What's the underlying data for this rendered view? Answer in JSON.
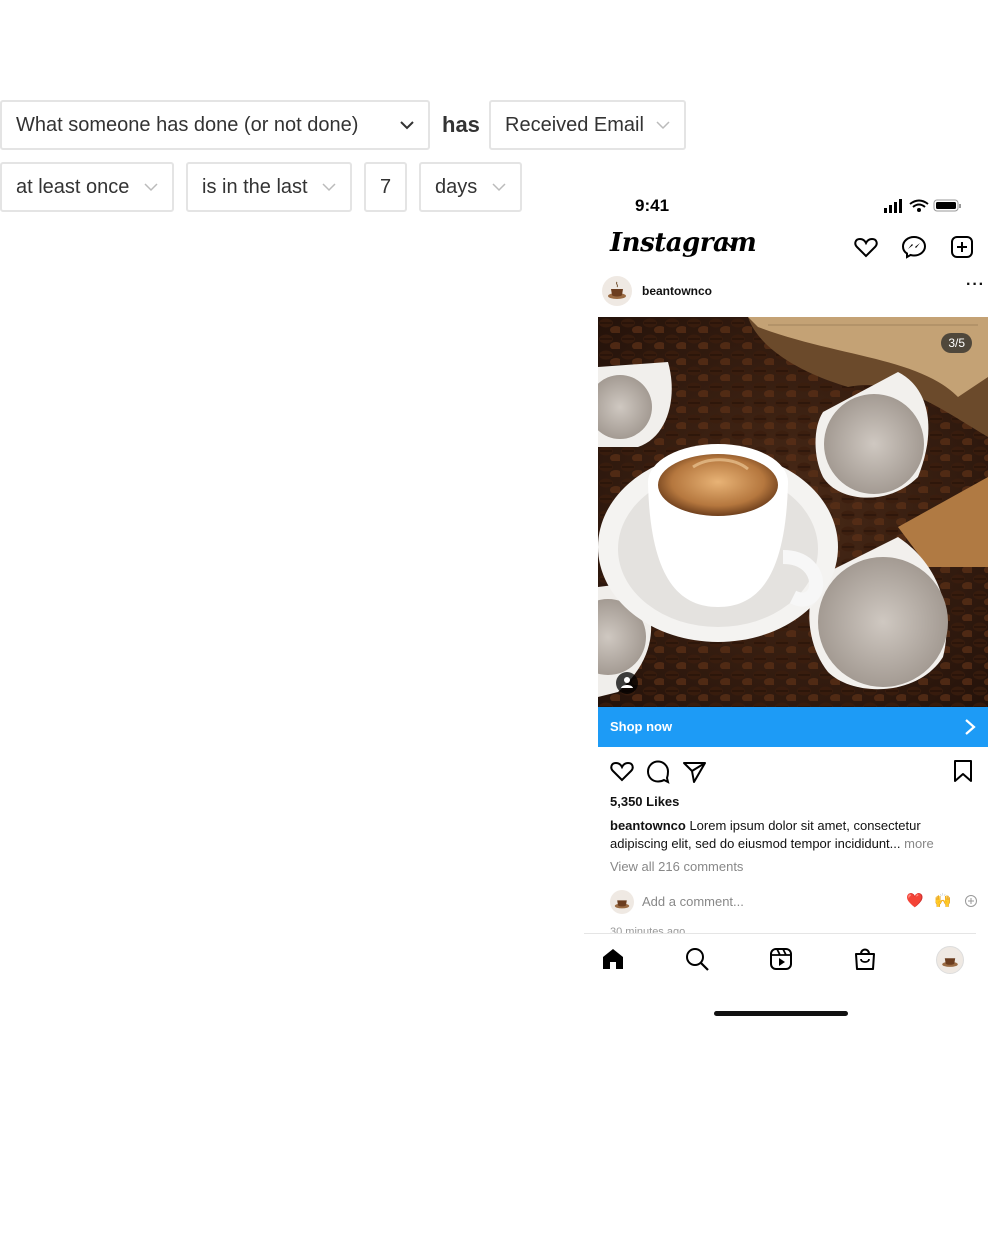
{
  "filter": {
    "condition_select": "What someone has done (or not done)",
    "has_label": "has",
    "event_select": "Received Email",
    "frequency_select": "at least once",
    "time_operator_select": "is in the last",
    "time_value": "7",
    "time_unit_select": "days"
  },
  "phone": {
    "status_time": "9:41",
    "app_logo": "Instagram",
    "post": {
      "username": "beantownco",
      "image_counter": "3/5",
      "cta_label": "Shop now",
      "likes": "5,350 Likes",
      "caption_user": "beantownco",
      "caption_text": " Lorem ipsum dolor sit amet, consectetur adipiscing elit, sed do eiusmod tempor incididunt... ",
      "caption_more": "more",
      "view_comments": "View all 216 comments",
      "add_comment_placeholder": "Add a comment...",
      "time_ago": "30 minutes ago",
      "quick_reactions": [
        "❤️",
        "🙌"
      ]
    },
    "icons": {
      "header": [
        "heart-icon",
        "messenger-icon",
        "add-post-icon"
      ],
      "actions": [
        "like-icon",
        "comment-icon",
        "share-icon",
        "save-icon"
      ],
      "nav": [
        "home-icon",
        "search-icon",
        "reels-icon",
        "shop-icon",
        "profile-avatar"
      ]
    },
    "colors": {
      "cta": "#1d9bf6"
    }
  }
}
